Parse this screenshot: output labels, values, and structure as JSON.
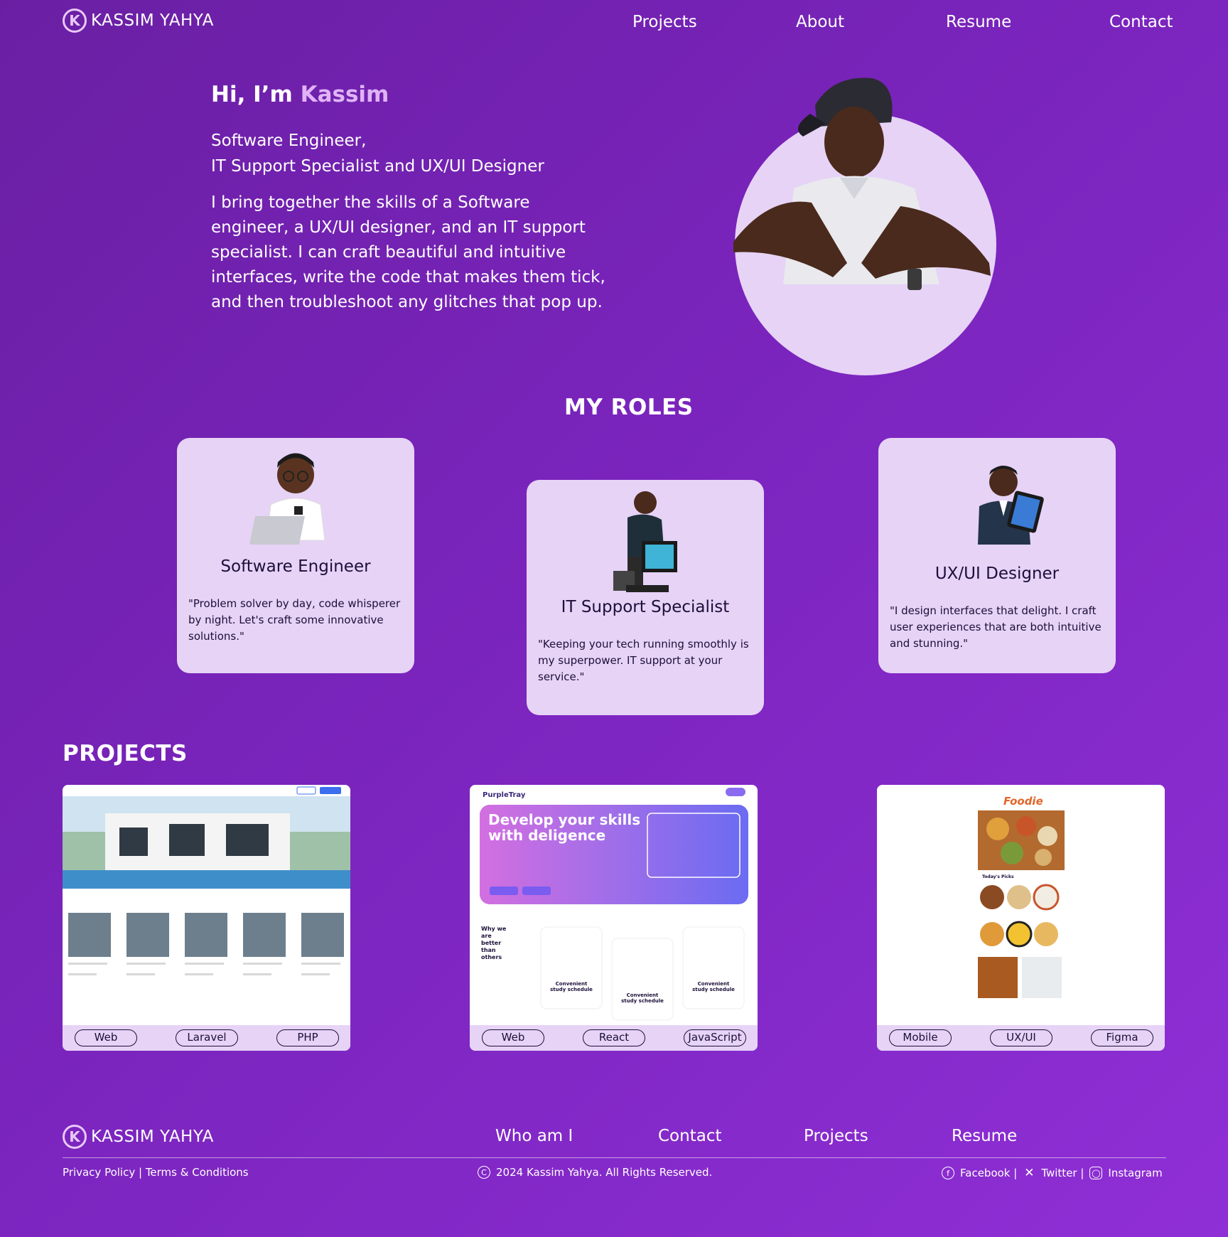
{
  "brand": {
    "name": "KASSIM YAHYA",
    "mark": "K"
  },
  "nav": {
    "projects": "Projects",
    "about": "About",
    "resume": "Resume",
    "contact": "Contact"
  },
  "hero": {
    "greeting": "Hi, I’m",
    "name": "Kassim",
    "role_line1": "Software Engineer,",
    "role_line2": "IT Support Specialist and UX/UI Designer",
    "bio": "I bring together the skills of a Software engineer, a UX/UI designer, and an IT support specialist. I can craft beautiful and intuitive interfaces, write the code that makes them tick, and then troubleshoot any glitches that pop up."
  },
  "roles": {
    "heading": "MY ROLES",
    "items": [
      {
        "title": "Software Engineer",
        "quote": "\"Problem solver by day, code whisperer by night. Let's craft some innovative solutions.\""
      },
      {
        "title": "IT Support Specialist",
        "quote": "\"Keeping your tech running smoothly is my superpower. IT support at your service.\""
      },
      {
        "title": "UX/UI Designer",
        "quote": "\"I design interfaces that delight. I craft user experiences that are both intuitive and stunning.\""
      }
    ]
  },
  "projects": {
    "heading": "PROJECTS",
    "items": [
      {
        "tags": [
          "Web",
          "Laravel",
          "PHP"
        ]
      },
      {
        "tags": [
          "Web",
          "React",
          "JavaScript"
        ],
        "headline": "Develop your skills with deligence",
        "logo": "PurpleTray",
        "side_text": "Why we are better than others",
        "feature": "Convenient study schedule"
      },
      {
        "tags": [
          "Mobile",
          "UX/UI",
          "Figma"
        ],
        "logo": "Foodie",
        "section": "Today's Picks"
      }
    ]
  },
  "footer": {
    "links": {
      "who": "Who am I",
      "contact": "Contact",
      "projects": "Projects",
      "resume": "Resume"
    },
    "legal": "Privacy Policy | Terms & Conditions",
    "copyright": "2024 Kassim Yahya. All Rights Reserved.",
    "facebook": "Facebook |",
    "twitter": "Twitter |",
    "instagram": "Instagram"
  },
  "colors": {
    "card": "#e6d3f6",
    "accent": "#e0b3f7",
    "ink": "#1d0f3a"
  }
}
